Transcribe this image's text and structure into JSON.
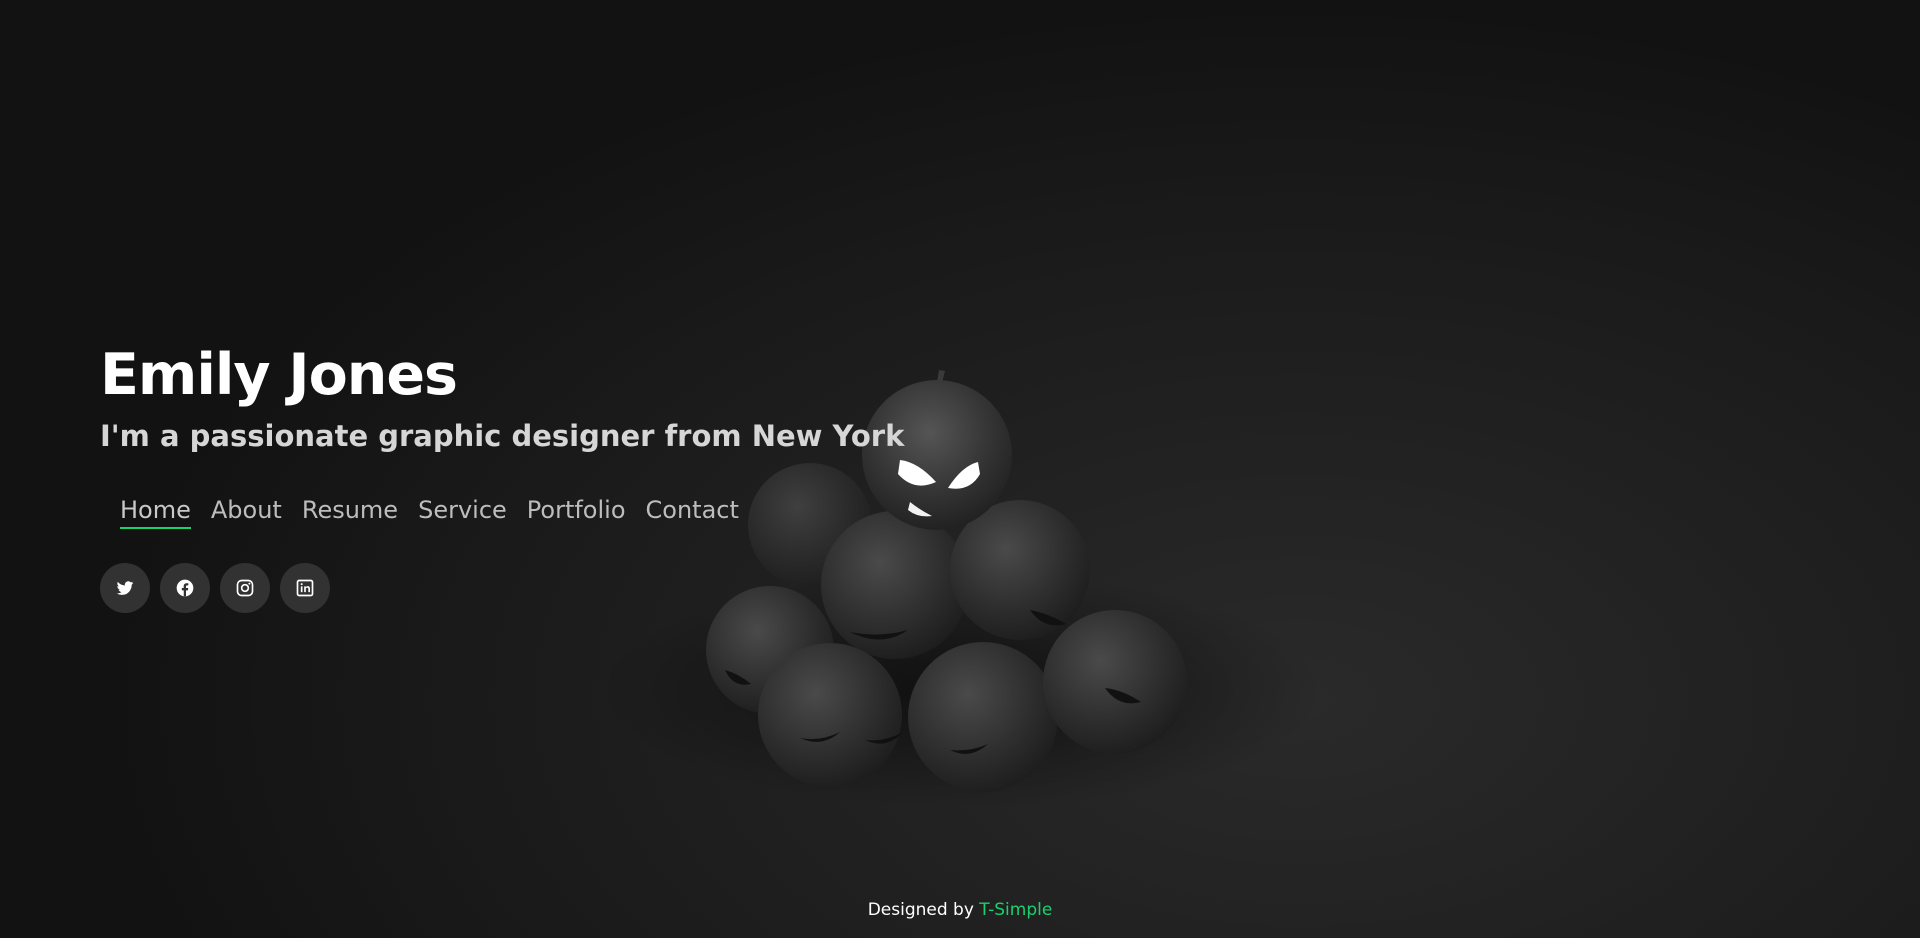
{
  "hero": {
    "name": "Emily Jones",
    "tagline": "I'm a passionate graphic designer from New York"
  },
  "nav": {
    "items": [
      {
        "label": "Home",
        "active": true
      },
      {
        "label": "About",
        "active": false
      },
      {
        "label": "Resume",
        "active": false
      },
      {
        "label": "Service",
        "active": false
      },
      {
        "label": "Portfolio",
        "active": false
      },
      {
        "label": "Contact",
        "active": false
      }
    ],
    "active_underline_color": "#18d26e"
  },
  "social": {
    "icons": [
      "twitter-icon",
      "facebook-icon",
      "instagram-icon",
      "linkedin-icon"
    ]
  },
  "footer": {
    "prefix": "Designed by",
    "brand": "T-Simple",
    "brand_color": "#18d26e"
  },
  "background": {
    "image": "pile of dark carved pumpkins, one with glowing eyes"
  }
}
